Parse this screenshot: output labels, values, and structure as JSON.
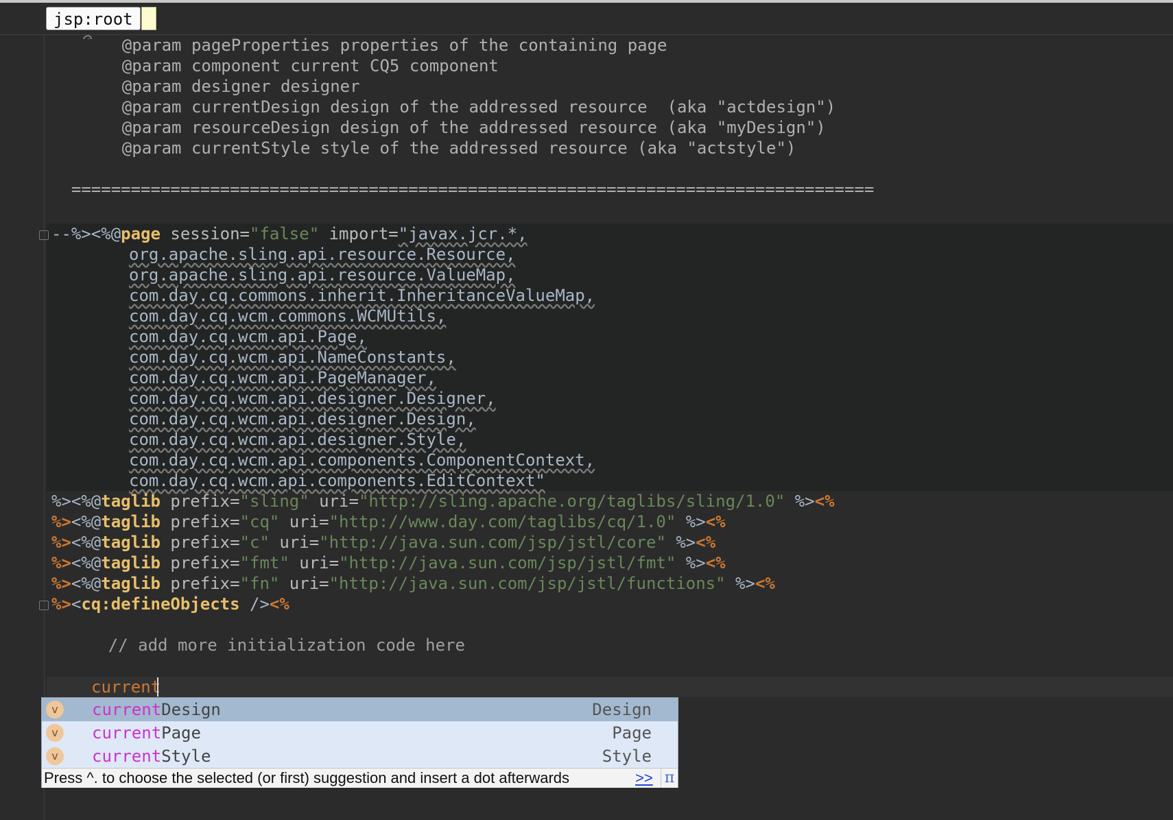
{
  "breadcrumb": {
    "label": "jsp:root"
  },
  "editor": {
    "comment_lines": [
      "    @param pageProperties properties of the containing page",
      "    @param component current CQ5 component",
      "    @param designer designer",
      "    @param currentDesign design of the addressed resource  (aka \"actdesign\")",
      "    @param resourceDesign design of the addressed resource (aka \"myDesign\")",
      "    @param currentStyle style of the addressed resource (aka \"actstyle\")"
    ],
    "separator": "  =================================================================================",
    "page_directive": {
      "open": "--%><%@",
      "name": "page",
      "attr1": " session=",
      "val1": "\"false\"",
      "attr2": " import=",
      "import_first": "\"javax.jcr.*,"
    },
    "imports": [
      "org.apache.sling.api.resource.Resource,",
      "org.apache.sling.api.resource.ValueMap,",
      "com.day.cq.commons.inherit.InheritanceValueMap,",
      "com.day.cq.wcm.commons.WCMUtils,",
      "com.day.cq.wcm.api.Page,",
      "com.day.cq.wcm.api.NameConstants,",
      "com.day.cq.wcm.api.PageManager,",
      "com.day.cq.wcm.api.designer.Designer,",
      "com.day.cq.wcm.api.designer.Design,",
      "com.day.cq.wcm.api.designer.Style,",
      "com.day.cq.wcm.api.components.ComponentContext,",
      "com.day.cq.wcm.api.components.EditContext\""
    ],
    "taglibs": [
      {
        "prefix": "\"sling\"",
        "uri": "\"http://sling.apache.org/taglibs/sling/1.0\""
      },
      {
        "prefix": "\"cq\"",
        "uri": "\"http://www.day.com/taglibs/cq/1.0\""
      },
      {
        "prefix": "\"c\"",
        "uri": "\"http://java.sun.com/jsp/jstl/core\""
      },
      {
        "prefix": "\"fmt\"",
        "uri": "\"http://java.sun.com/jsp/jstl/fmt\""
      },
      {
        "prefix": "\"fn\"",
        "uri": "\"http://java.sun.com/jsp/jstl/functions\""
      }
    ],
    "define_objects": {
      "tag": "cq:defineObjects",
      "close": " />"
    },
    "line_comment": "    // add more initialization code here",
    "typed_text": "current"
  },
  "completion": {
    "items": [
      {
        "match": "current",
        "rest": "Design",
        "type": "Design",
        "icon": "v",
        "selected": true
      },
      {
        "match": "current",
        "rest": "Page",
        "type": "Page",
        "icon": "v",
        "selected": false
      },
      {
        "match": "current",
        "rest": "Style",
        "type": "Style",
        "icon": "v",
        "selected": false
      }
    ],
    "hint": "Press ^. to choose the selected (or first) suggestion and insert a dot afterwards",
    "more_link": ">>",
    "pin_icon": "π"
  }
}
